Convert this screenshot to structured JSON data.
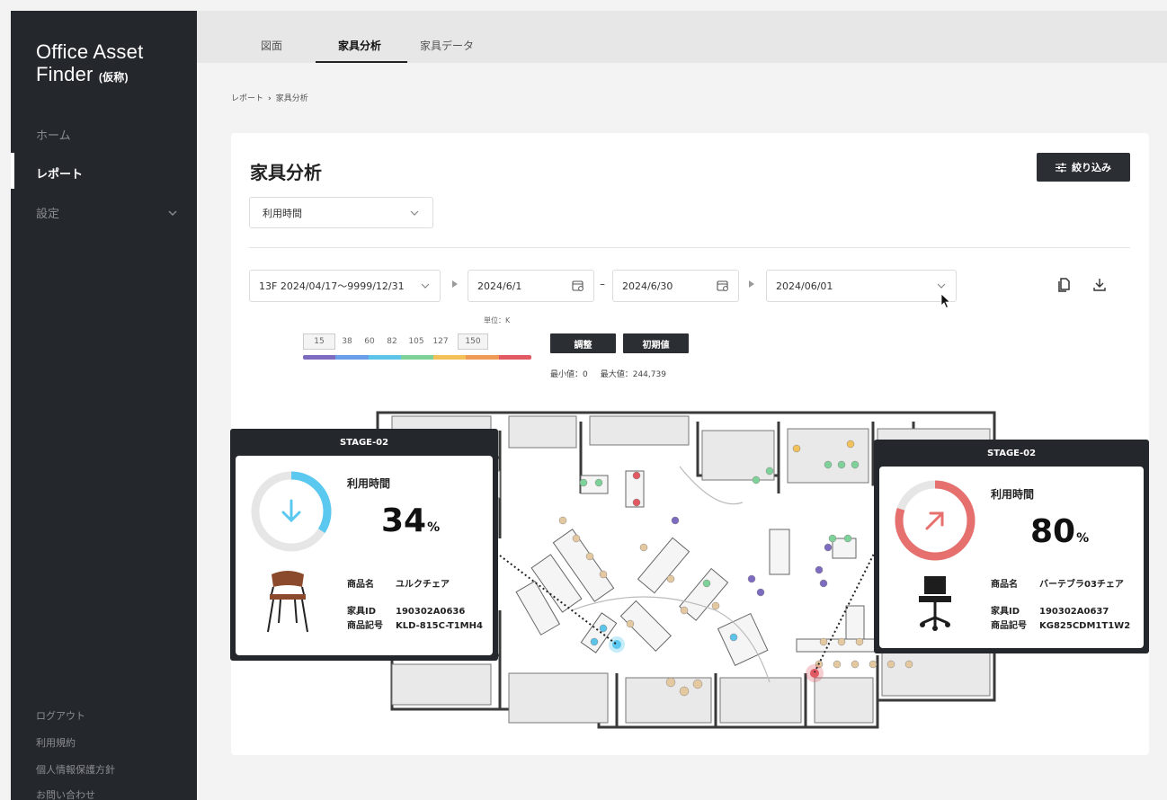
{
  "app": {
    "brand_line1": "Office Asset",
    "brand_line2": "Finder",
    "brand_suffix": "(仮称)"
  },
  "sidebar": {
    "items": [
      {
        "label": "ホーム"
      },
      {
        "label": "レポート",
        "active": true
      },
      {
        "label": "設定"
      }
    ],
    "footer": [
      "ログアウト",
      "利用規約",
      "個人情報保護方針",
      "お問い合わせ"
    ]
  },
  "tabs": [
    "図面",
    "家具分析",
    "家具データ"
  ],
  "active_tab": "家具分析",
  "breadcrumb": {
    "parent": "レポート",
    "sep": "›",
    "current": "家具分析"
  },
  "page": {
    "title": "家具分析",
    "filter_label": "絞り込み",
    "metric_select": "利用時間"
  },
  "controls": {
    "layout_select": "13F 2024/04/17〜9999/12/31",
    "date_from": "2024/6/1",
    "date_range_sep": "–",
    "date_to": "2024/6/30",
    "date_select": "2024/06/01"
  },
  "legend": {
    "unit": "単位：K",
    "ticks": [
      "15",
      "38",
      "60",
      "82",
      "105",
      "127",
      "150"
    ],
    "colors": [
      "#7d6bbf",
      "#6a9ee6",
      "#5bc4e8",
      "#7fd19a",
      "#f2c15a",
      "#ef9a55",
      "#e15a63"
    ],
    "adjust_label": "調整",
    "reset_label": "初期値",
    "min_label": "最小値：0",
    "max_label": "最大値：244,739"
  },
  "popups": [
    {
      "stage": "STAGE-02",
      "metric": "利用時間",
      "value": "34",
      "unit": "%",
      "percent": 34,
      "trend": "down",
      "color": "#5bc8ef",
      "product_name_label": "商品名",
      "product_name": "ユルクチェア",
      "furniture_id_label": "家具ID",
      "furniture_id": "190302A0636",
      "product_code_label": "商品記号",
      "product_code": "KLD-815C-T1MH4"
    },
    {
      "stage": "STAGE-02",
      "metric": "利用時間",
      "value": "80",
      "unit": "%",
      "percent": 80,
      "trend": "up",
      "color": "#e5706e",
      "product_name_label": "商品名",
      "product_name": "バーテブラ03チェア",
      "furniture_id_label": "家具ID",
      "furniture_id": "190302A0637",
      "product_code_label": "商品記号",
      "product_code": "KG825CDM1T1W2"
    }
  ]
}
